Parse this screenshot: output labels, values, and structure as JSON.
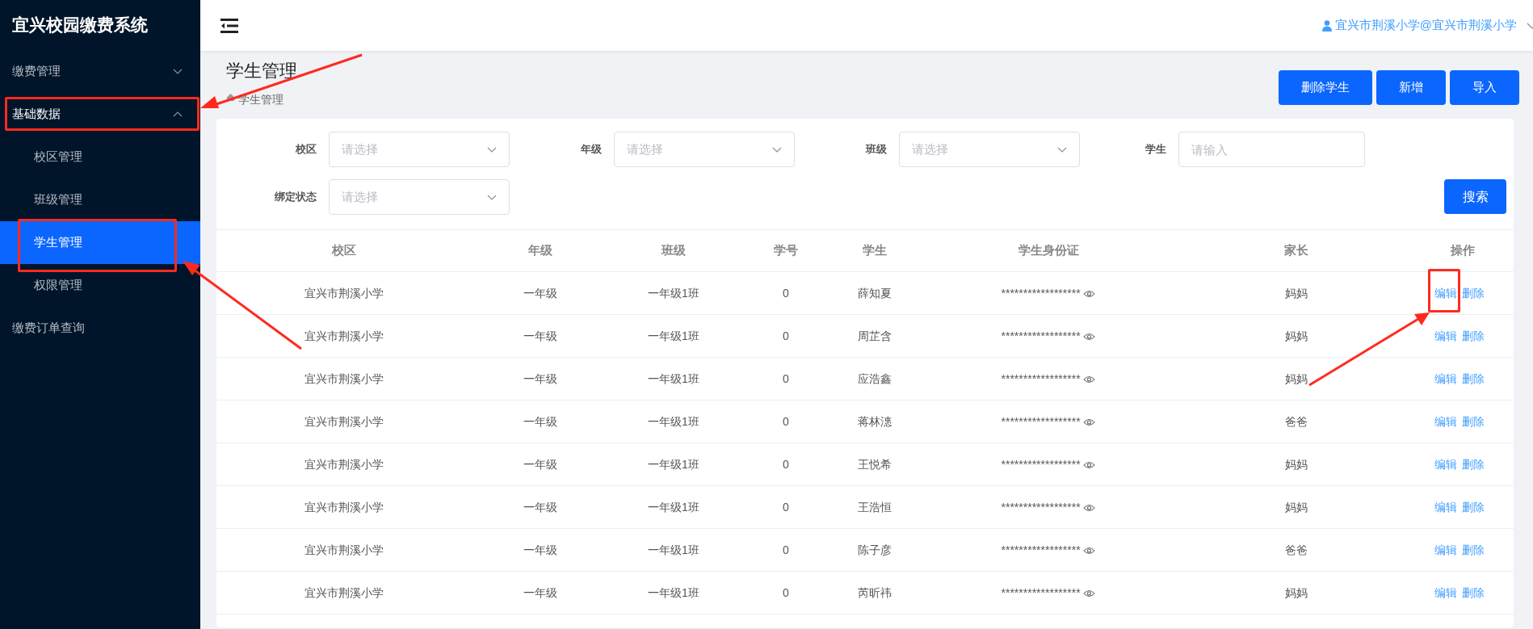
{
  "sidebar": {
    "title": "宜兴校园缴费系统",
    "items": [
      {
        "label": "缴费管理",
        "expanded": false,
        "selected": false
      },
      {
        "label": "基础数据",
        "expanded": true,
        "selected": false,
        "children": [
          {
            "label": "校区管理",
            "selected": false
          },
          {
            "label": "班级管理",
            "selected": false
          },
          {
            "label": "学生管理",
            "selected": true
          },
          {
            "label": "权限管理",
            "selected": false
          }
        ]
      },
      {
        "label": "缴费订单查询",
        "selected": false
      }
    ]
  },
  "header": {
    "user": "宜兴市荆溪小学@宜兴市荆溪小学"
  },
  "page": {
    "title": "学生管理",
    "breadcrumb": "学生管理",
    "actions": [
      "删除学生",
      "新增",
      "导入"
    ]
  },
  "filters": [
    {
      "kind": "select",
      "label": "校区",
      "placeholder": "请选择"
    },
    {
      "kind": "select",
      "label": "年级",
      "placeholder": "请选择"
    },
    {
      "kind": "select",
      "label": "班级",
      "placeholder": "请选择"
    },
    {
      "kind": "input",
      "label": "学生",
      "placeholder": "请输入"
    },
    {
      "kind": "select",
      "label": "绑定状态",
      "placeholder": "请选择"
    }
  ],
  "search_button": "搜索",
  "table": {
    "columns": [
      "校区",
      "年级",
      "班级",
      "学号",
      "学生",
      "学生身份证",
      "家长",
      "操作"
    ],
    "rows": [
      {
        "cells": [
          "宜兴市荆溪小学",
          "一年级",
          "一年级1班",
          "0",
          "薛知夏",
          "******************",
          "妈妈"
        ],
        "actions": [
          "编辑",
          "删除"
        ]
      },
      {
        "cells": [
          "宜兴市荆溪小学",
          "一年级",
          "一年级1班",
          "0",
          "周芷含",
          "******************",
          "妈妈"
        ],
        "actions": [
          "编辑",
          "删除"
        ]
      },
      {
        "cells": [
          "宜兴市荆溪小学",
          "一年级",
          "一年级1班",
          "0",
          "应浩鑫",
          "******************",
          "妈妈"
        ],
        "actions": [
          "编辑",
          "删除"
        ]
      },
      {
        "cells": [
          "宜兴市荆溪小学",
          "一年级",
          "一年级1班",
          "0",
          "蒋林潓",
          "******************",
          "爸爸"
        ],
        "actions": [
          "编辑",
          "删除"
        ]
      },
      {
        "cells": [
          "宜兴市荆溪小学",
          "一年级",
          "一年级1班",
          "0",
          "王悦希",
          "******************",
          "妈妈"
        ],
        "actions": [
          "编辑",
          "删除"
        ]
      },
      {
        "cells": [
          "宜兴市荆溪小学",
          "一年级",
          "一年级1班",
          "0",
          "王浩恒",
          "******************",
          "妈妈"
        ],
        "actions": [
          "编辑",
          "删除"
        ]
      },
      {
        "cells": [
          "宜兴市荆溪小学",
          "一年级",
          "一年级1班",
          "0",
          "陈子彦",
          "******************",
          "爸爸"
        ],
        "actions": [
          "编辑",
          "删除"
        ]
      },
      {
        "cells": [
          "宜兴市荆溪小学",
          "一年级",
          "一年级1班",
          "0",
          "芮昕祎",
          "******************",
          "妈妈"
        ],
        "actions": [
          "编辑",
          "删除"
        ]
      }
    ]
  }
}
